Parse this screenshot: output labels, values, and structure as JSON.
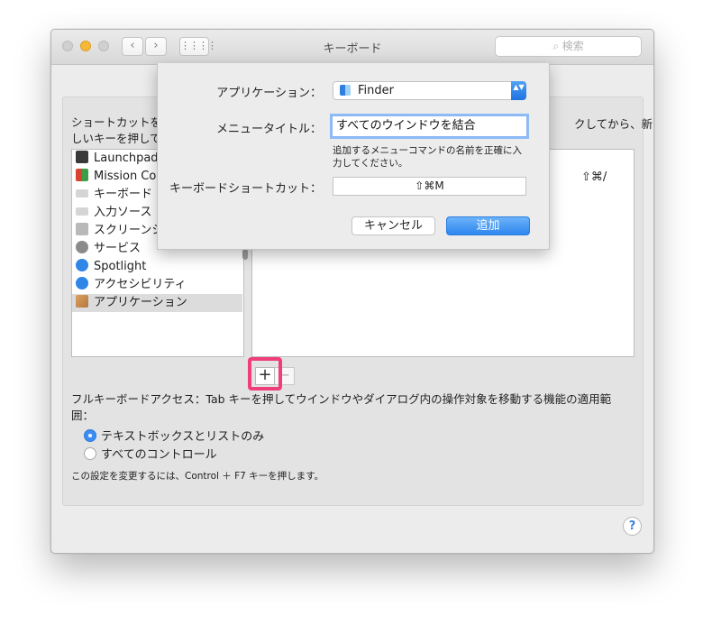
{
  "window": {
    "title": "キーボード",
    "search_placeholder": "検索"
  },
  "nav": {
    "back_glyph": "‹",
    "forward_glyph": "›",
    "grid_glyph": "⋮⋮⋮⋮"
  },
  "main": {
    "description_line1": "ショートカットを",
    "description_line2": "しいキーを押して",
    "description_tail": "クしてから、新",
    "sidebar_items": [
      {
        "label": "Launchpad",
        "icon": "launchpad-icon",
        "color": "#3a3a3a"
      },
      {
        "label": "Mission Co",
        "icon": "mission-control-icon",
        "color": "#d9442f"
      },
      {
        "label": "キーボード",
        "icon": "keyboard-icon",
        "color": "#c8c8c8"
      },
      {
        "label": "入力ソース",
        "icon": "input-sources-icon",
        "color": "#c8c8c8"
      },
      {
        "label": "スクリーンシ",
        "icon": "screenshot-icon",
        "color": "#9c9c9c"
      },
      {
        "label": "サービス",
        "icon": "services-gear-icon",
        "color": "#8a8a8a"
      },
      {
        "label": "Spotlight",
        "icon": "spotlight-icon",
        "color": "#2f86e6"
      },
      {
        "label": "アクセシビリティ",
        "icon": "accessibility-icon",
        "color": "#2f86e6"
      },
      {
        "label": "アプリケーション",
        "icon": "applications-icon",
        "color": "#b07840"
      }
    ],
    "shortcut_hint": "⇧⌘/",
    "plus_label": "+",
    "minus_label": "−",
    "fka_text": "フルキーボードアクセス：Tab キーを押してウインドウやダイアログ内の操作対象を移動する機能の適用範囲：",
    "radio_options": [
      {
        "label": "テキストボックスとリストのみ",
        "checked": true
      },
      {
        "label": "すべてのコントロール",
        "checked": false
      }
    ],
    "note": "この設定を変更するには、Control ＋ F7 キーを押します。",
    "help_label": "?"
  },
  "sheet": {
    "app_label": "アプリケーション：",
    "app_value": "Finder",
    "app_arrows": "▲▼",
    "menu_title_label": "メニュータイトル：",
    "menu_title_value": "すべてのウインドウを結合",
    "hint": "追加するメニューコマンドの名前を正確に入力してください。",
    "shortcut_label": "キーボードショートカット：",
    "shortcut_value": "⇧⌘M",
    "cancel_label": "キャンセル",
    "add_label": "追加"
  },
  "colors": {
    "accent": "#2e86ef",
    "highlight": "#ef3e78"
  }
}
